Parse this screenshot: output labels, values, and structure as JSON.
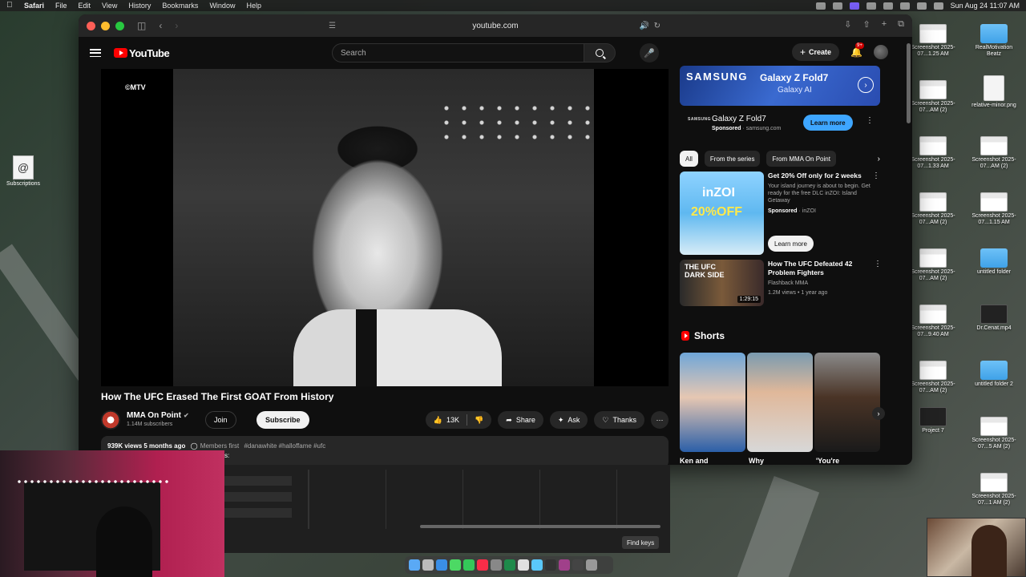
{
  "menubar": {
    "app": "Safari",
    "items": [
      "File",
      "Edit",
      "View",
      "History",
      "Bookmarks",
      "Window",
      "Help"
    ],
    "clock": "Sun Aug 24  11:07 AM"
  },
  "browser": {
    "url": "youtube.com"
  },
  "youtube": {
    "logo_text": "YouTube",
    "search_placeholder": "Search",
    "create_label": "Create",
    "notif_count": "9+",
    "video": {
      "watermark": "©MTV",
      "title": "How The UFC Erased The First GOAT From History",
      "channel": "MMA On Point",
      "subscribers": "1.14M subscribers",
      "join_label": "Join",
      "subscribe_label": "Subscribe",
      "likes": "13K",
      "share_label": "Share",
      "ask_label": "Ask",
      "thanks_label": "Thanks",
      "views_line": "939K views  5 months ago",
      "members_first": "Members first",
      "tags": "#danawhite #halloffame #ufc"
    },
    "ad": {
      "brand": "SAMSUNG",
      "headline": "Galaxy Z Fold7",
      "subline": "Galaxy AI",
      "logo_small": "SAMSUNG",
      "name": "Galaxy Z Fold7",
      "sponsored": "Sponsored",
      "domain": "samsung.com",
      "cta": "Learn more"
    },
    "chips": [
      "All",
      "From the series",
      "From MMA On Point"
    ],
    "recs": [
      {
        "title": "Get 20% Off only for 2 weeks",
        "desc": "Your island journey is about to begin. Get ready for the free DLC inZOI: Island Getaway",
        "sponsored": "Sponsored",
        "advertiser": "inZOI",
        "cta": "Learn more",
        "thumb_brand": "inZOI",
        "thumb_offer": "20%OFF"
      },
      {
        "title": "How The UFC Defeated 42 Problem Fighters",
        "channel": "Flashback MMA",
        "meta": "1.2M views • 1 year ago",
        "duration": "1:29:15",
        "thumb_text": "THE UFC DARK SIDE"
      }
    ],
    "shorts_heading": "Shorts",
    "shorts": [
      "Ken and",
      "Why",
      "'You're"
    ]
  },
  "desktop": {
    "left_icon": "Subscriptions",
    "icons": [
      {
        "label": "Screenshot 2025-07...1.25 AM",
        "kind": "shot"
      },
      {
        "label": "RealMotivation Beatz",
        "kind": "folder"
      },
      {
        "label": "Screenshot 2025-07...AM (2)",
        "kind": "shot"
      },
      {
        "label": "relative-minor.png",
        "kind": "doc"
      },
      {
        "label": "Screenshot 2025-07...1.33 AM",
        "kind": "shot"
      },
      {
        "label": "Screenshot 2025-07...AM (2)",
        "kind": "shot"
      },
      {
        "label": "Screenshot 2025-07...AM (2)",
        "kind": "shot"
      },
      {
        "label": "Screenshot 2025-07...1.15 AM",
        "kind": "shot"
      },
      {
        "label": "Screenshot 2025-07...AM (2)",
        "kind": "shot"
      },
      {
        "label": "untitled folder",
        "kind": "folder"
      },
      {
        "label": "Screenshot 2025-07...9.40 AM",
        "kind": "shot"
      },
      {
        "label": "Dr.Cenat.mp4",
        "kind": "dark"
      },
      {
        "label": "Screenshot 2025-07...AM (2)",
        "kind": "shot"
      },
      {
        "label": "untitled folder 2",
        "kind": "folder"
      },
      {
        "label": "Project 7",
        "kind": "dark"
      },
      {
        "label": "Screenshot 2025-07...5 AM (2)",
        "kind": "shot"
      },
      {
        "label": "Screenshot 2025-07...1 AM (2)",
        "kind": "shot"
      }
    ]
  },
  "editor": {
    "overlay_text": "s:",
    "find_keys": "Find keys"
  }
}
